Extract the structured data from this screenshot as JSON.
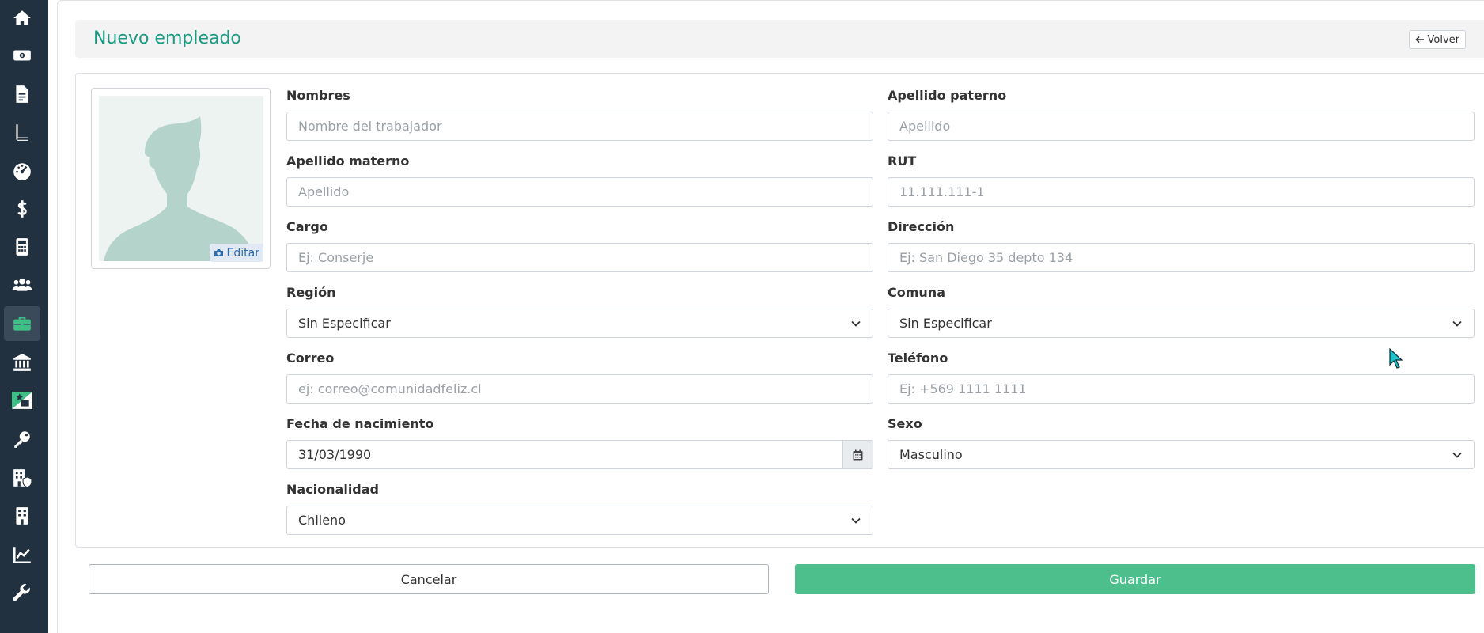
{
  "sidebar": {
    "items": [
      {
        "icon": "home-icon"
      },
      {
        "icon": "money-bill-icon"
      },
      {
        "icon": "file-icon"
      },
      {
        "icon": "book-icon"
      },
      {
        "icon": "gauge-icon"
      },
      {
        "icon": "dollar-icon"
      },
      {
        "icon": "calculator-icon"
      },
      {
        "icon": "users-icon"
      },
      {
        "icon": "briefcase-icon",
        "active": true
      },
      {
        "icon": "bank-icon"
      },
      {
        "icon": "star-ticket-icon"
      },
      {
        "icon": "key-icon"
      },
      {
        "icon": "building-shield-icon"
      },
      {
        "icon": "building-icon"
      },
      {
        "icon": "chart-line-icon"
      },
      {
        "icon": "wrench-icon"
      }
    ]
  },
  "header": {
    "title": "Nuevo empleado",
    "back_label": "Volver"
  },
  "photo": {
    "edit_label": "Editar"
  },
  "form": {
    "nombres": {
      "label": "Nombres",
      "placeholder": "Nombre del trabajador"
    },
    "apellido_paterno": {
      "label": "Apellido paterno",
      "placeholder": "Apellido"
    },
    "apellido_materno": {
      "label": "Apellido materno",
      "placeholder": "Apellido"
    },
    "rut": {
      "label": "RUT",
      "placeholder": "11.111.111-1"
    },
    "cargo": {
      "label": "Cargo",
      "placeholder": "Ej: Conserje"
    },
    "direccion": {
      "label": "Dirección",
      "placeholder": "Ej: San Diego 35 depto 134"
    },
    "region": {
      "label": "Región",
      "value": "Sin Especificar"
    },
    "comuna": {
      "label": "Comuna",
      "value": "Sin Especificar"
    },
    "correo": {
      "label": "Correo",
      "placeholder": "ej: correo@comunidadfeliz.cl"
    },
    "telefono": {
      "label": "Teléfono",
      "placeholder": "Ej: +569 1111 1111"
    },
    "fecha_nacimiento": {
      "label": "Fecha de nacimiento",
      "value": "31/03/1990"
    },
    "sexo": {
      "label": "Sexo",
      "value": "Masculino"
    },
    "nacionalidad": {
      "label": "Nacionalidad",
      "value": "Chileno"
    }
  },
  "actions": {
    "cancel_label": "Cancelar",
    "save_label": "Guardar"
  },
  "colors": {
    "sidebar_bg": "#22313f",
    "accent": "#1d9a83",
    "save_button": "#4cbf8c"
  }
}
